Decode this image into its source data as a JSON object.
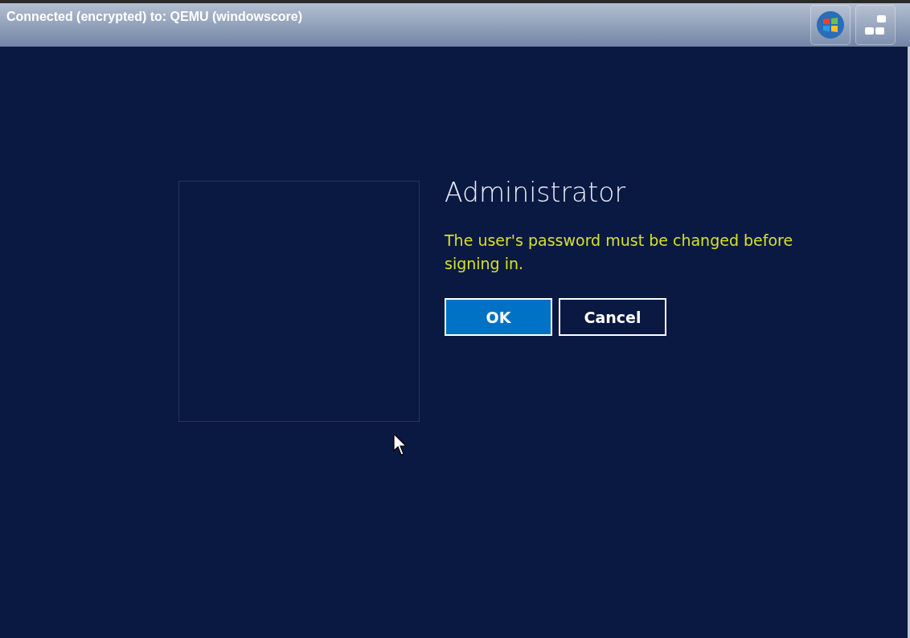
{
  "connection_bar": {
    "title": "Connected (encrypted) to: QEMU (windowscore)"
  },
  "sign_in": {
    "user_name": "Administrator",
    "message": "The user's password must be changed before signing in.",
    "buttons": [
      {
        "label": "OK",
        "selected": true
      },
      {
        "label": "Cancel",
        "selected": false
      }
    ]
  }
}
